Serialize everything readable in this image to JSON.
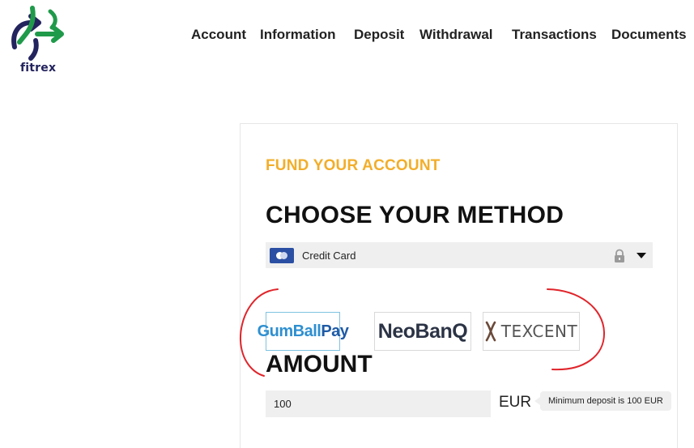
{
  "brand": {
    "name": "fitrex",
    "colors": {
      "green": "#1f9a4a",
      "navy": "#23235e",
      "accent": "#f2ae2a"
    }
  },
  "nav": {
    "items": [
      "Account",
      "Information",
      "Deposit",
      "Withdrawal",
      "Transactions",
      "Documents"
    ]
  },
  "panel": {
    "subtitle": "FUND YOUR ACCOUNT",
    "title": "CHOOSE YOUR METHOD",
    "method_select": {
      "icon": "credit-card-icon",
      "selected": "Credit Card"
    },
    "methods": [
      {
        "name": "GumBallPay",
        "part1": "GumBall",
        "part2": "Pay",
        "selected": true
      },
      {
        "name": "NeoBanQ",
        "selected": false
      },
      {
        "name": "TEXCENT",
        "selected": false
      }
    ],
    "amount": {
      "label": "AMOUNT",
      "value": "100",
      "currency": "EUR",
      "min_note": "Minimum deposit is  100 EUR"
    }
  },
  "annotation": {
    "color": "#e0252b",
    "shape": "red hand-drawn bracket circle around payment methods"
  }
}
